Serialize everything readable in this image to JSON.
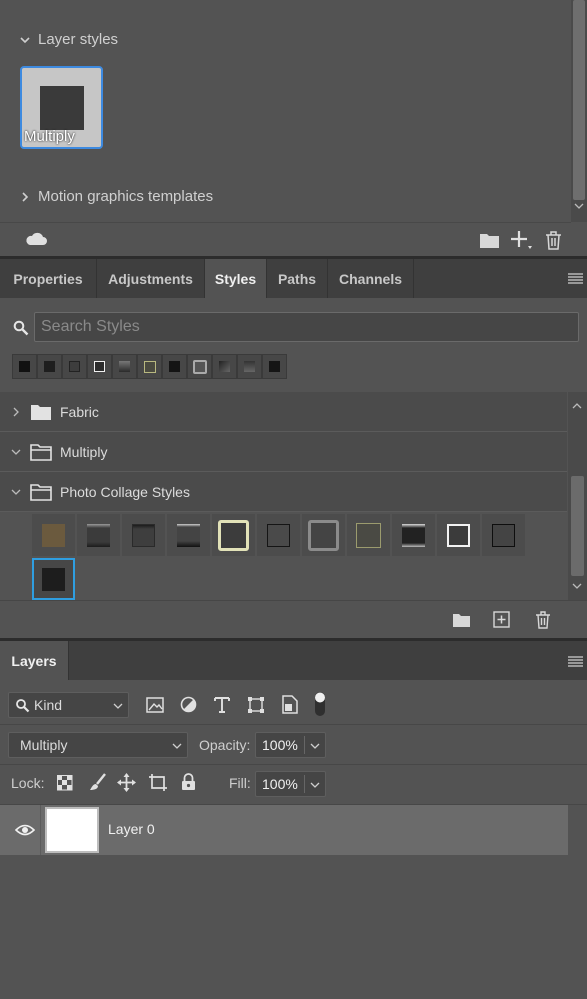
{
  "library": {
    "layer_styles_heading": "Layer styles",
    "tile_label": "Multiply",
    "motion_heading": "Motion graphics templates"
  },
  "styles_panel": {
    "tabs": [
      {
        "label": "Properties"
      },
      {
        "label": "Adjustments"
      },
      {
        "label": "Styles"
      },
      {
        "label": "Paths"
      },
      {
        "label": "Channels"
      }
    ],
    "active_tab": "Styles",
    "search_placeholder": "Search Styles",
    "groups": [
      {
        "label": "Fabric",
        "expanded": false
      },
      {
        "label": "Multiply",
        "expanded": true
      },
      {
        "label": "Photo Collage Styles",
        "expanded": true
      }
    ]
  },
  "layers_panel": {
    "tab_label": "Layers",
    "filter_kind": "Kind",
    "blend_mode": "Multiply",
    "opacity_label": "Opacity:",
    "opacity_value": "100%",
    "lock_label": "Lock:",
    "fill_label": "Fill:",
    "fill_value": "100%",
    "layers": [
      {
        "name": "Layer 0",
        "visible": true
      }
    ]
  },
  "colors": {
    "panel_bg": "#535353",
    "tab_bar_bg": "#3f3f3f",
    "selection_blue": "#3d8ae0",
    "swatch_selected_border": "#2f9ee0"
  }
}
